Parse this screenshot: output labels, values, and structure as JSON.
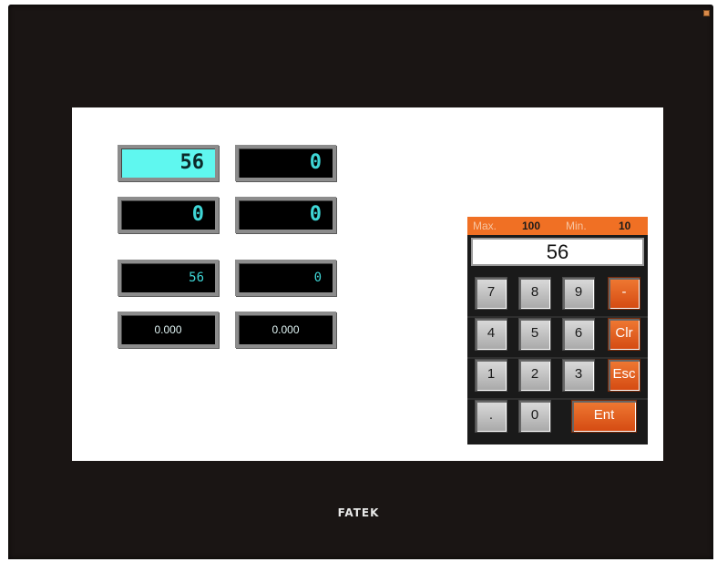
{
  "device": {
    "brand": "FATEK"
  },
  "fields": [
    {
      "name": "field-1",
      "value": "56",
      "selected": true
    },
    {
      "name": "field-2",
      "value": "0"
    },
    {
      "name": "field-3",
      "value": "0"
    },
    {
      "name": "field-4",
      "value": "0"
    },
    {
      "name": "field-5",
      "value": "56"
    },
    {
      "name": "field-6",
      "value": "0"
    },
    {
      "name": "field-7",
      "value": "0.000"
    },
    {
      "name": "field-8",
      "value": "0.000"
    }
  ],
  "keypad": {
    "max_label": "Max.",
    "max_value": "100",
    "min_label": "Min.",
    "min_value": "10",
    "display_value": "56",
    "keys": {
      "k7": "7",
      "k8": "8",
      "k9": "9",
      "minus": "-",
      "k4": "4",
      "k5": "5",
      "k6": "6",
      "clr": "Clr",
      "k1": "1",
      "k2": "2",
      "k3": "3",
      "esc": "Esc",
      "dot": ".",
      "k0": "0",
      "ent": "Ent"
    },
    "accent_color": "#f07024"
  },
  "colors": {
    "field_selected": "#5ff7ef",
    "field_text": "#3fd6d6",
    "bezel": "#1a1514"
  }
}
